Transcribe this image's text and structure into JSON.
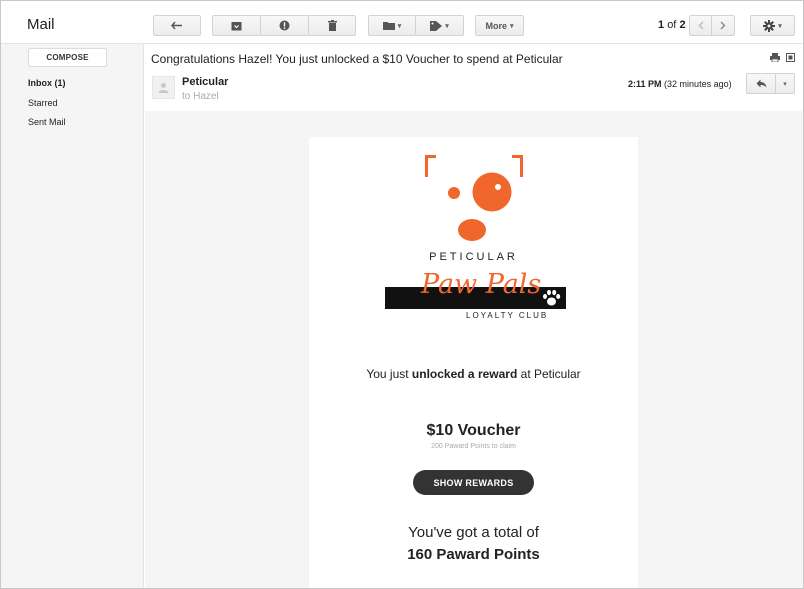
{
  "app": {
    "title": "Mail"
  },
  "toolbar": {
    "more_label": "More",
    "pager_current": "1",
    "pager_sep": "of",
    "pager_total": "2",
    "icons": [
      "back-arrow-icon",
      "archive-icon",
      "spam-icon",
      "trash-icon",
      "folder-icon",
      "label-icon",
      "chevron-left-icon",
      "chevron-right-icon",
      "gear-icon"
    ]
  },
  "sidebar": {
    "compose_label": "COMPOSE",
    "items": [
      {
        "label": "Inbox (1)",
        "bold": true
      },
      {
        "label": "Starred",
        "bold": false
      },
      {
        "label": "Sent Mail",
        "bold": false
      }
    ]
  },
  "message": {
    "subject": "Congratulations Hazel! You just unlocked a $10 Voucher to spend at Peticular",
    "sender": "Peticular",
    "recipient": "to Hazel",
    "time": "2:11 PM",
    "time_ago": "(32 minutes ago)"
  },
  "email": {
    "brand_name": "PETICULAR",
    "club_script": "Paw Pals",
    "club_subtitle": "LOYALTY CLUB",
    "reward_prefix": "You just",
    "reward_bold": "unlocked a reward",
    "reward_suffix": "at Peticular",
    "voucher_title": "$10 Voucher",
    "voucher_sub": "200 Paward Points to claim",
    "cta_label": "SHOW REWARDS",
    "total_line": "You've got a total of",
    "points_line": "160 Paward Points"
  },
  "colors": {
    "brand_orange": "#f0662d",
    "cta_bg": "#333333",
    "sidebar_bg": "#f5f5f5"
  }
}
